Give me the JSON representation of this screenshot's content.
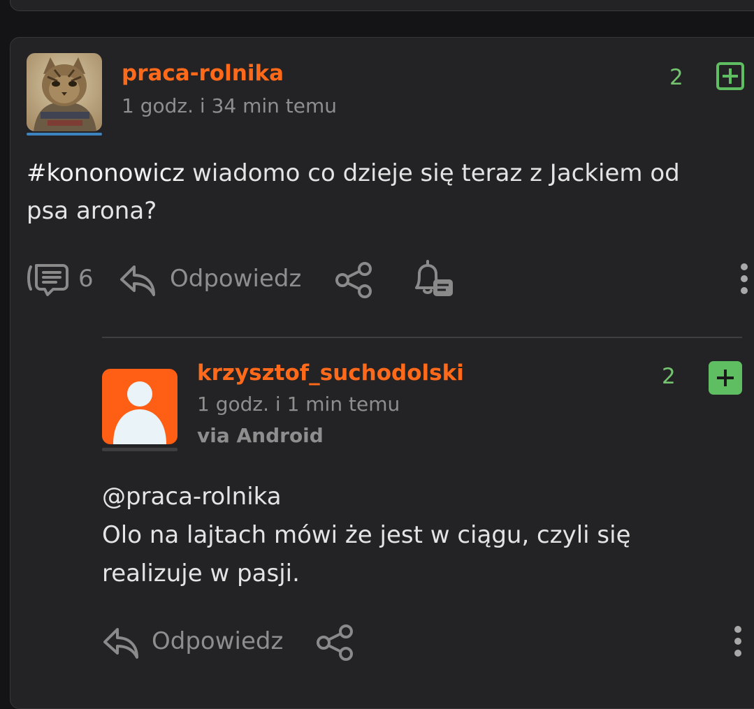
{
  "post": {
    "author": "praca-rolnika",
    "time": "1 godz. i 34 min temu",
    "score": "2",
    "tag": "#kononowicz",
    "text_rest": " wiadomo co dzieje się teraz z Jackiem od psa arona?",
    "comments_count": "6",
    "reply_label": "Odpowiedz"
  },
  "reply": {
    "author": "krzysztof_suchodolski",
    "time": "1 godz. i 1 min temu",
    "via": "via Android",
    "score": "2",
    "mention": "@praca-rolnika",
    "text": "Olo na lajtach mówi że jest w ciągu, czyli się realizuje w pasji.",
    "reply_label": "Odpowiedz"
  },
  "icons": {
    "comments": "comments-icon",
    "reply": "reply-arrow-icon",
    "share": "share-icon",
    "notify": "bell-notification-icon",
    "more": "more-vertical-icon",
    "upvote": "plus-icon",
    "avatar": "user-silhouette-icon"
  },
  "colors": {
    "username": "#ff6a1a",
    "score": "#74c370",
    "upvote": "#5fbd62",
    "card_bg": "#232325",
    "page_bg": "#141416",
    "default_avatar_bg": "#ff5f14"
  }
}
